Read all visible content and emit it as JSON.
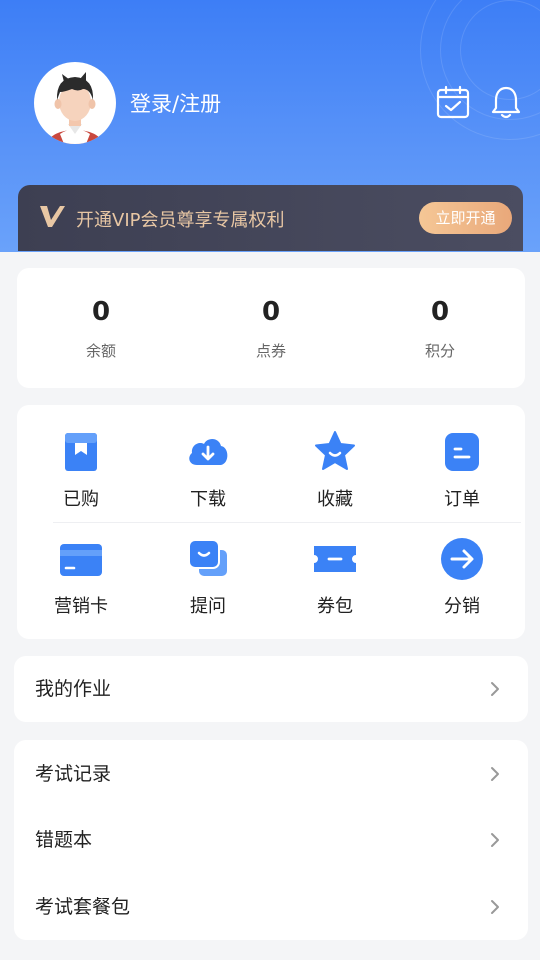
{
  "header": {
    "login_label": "登录/注册",
    "icons": [
      "calendar-check-icon",
      "bell-icon"
    ]
  },
  "vip": {
    "logo": "V",
    "text": "开通VIP会员尊享专属权利",
    "button": "立即开通"
  },
  "stats": [
    {
      "value": "0",
      "label": "余额"
    },
    {
      "value": "0",
      "label": "点券"
    },
    {
      "value": "0",
      "label": "积分"
    }
  ],
  "menu_grid": [
    {
      "label": "已购",
      "icon": "purchased-book-icon"
    },
    {
      "label": "下载",
      "icon": "cloud-download-icon"
    },
    {
      "label": "收藏",
      "icon": "star-icon"
    },
    {
      "label": "订单",
      "icon": "order-icon"
    },
    {
      "label": "营销卡",
      "icon": "card-icon"
    },
    {
      "label": "提问",
      "icon": "question-chat-icon"
    },
    {
      "label": "券包",
      "icon": "coupon-icon"
    },
    {
      "label": "分销",
      "icon": "arrow-right-circle-icon"
    }
  ],
  "list_homework": {
    "label": "我的作业"
  },
  "list_exam": [
    {
      "label": "考试记录"
    },
    {
      "label": "错题本"
    },
    {
      "label": "考试套餐包"
    }
  ],
  "colors": {
    "primary": "#3d7ef6",
    "vip_gold": "#e8c7a4",
    "vip_bg": "#3d3f52",
    "icon_blue": "#3b82f6"
  }
}
